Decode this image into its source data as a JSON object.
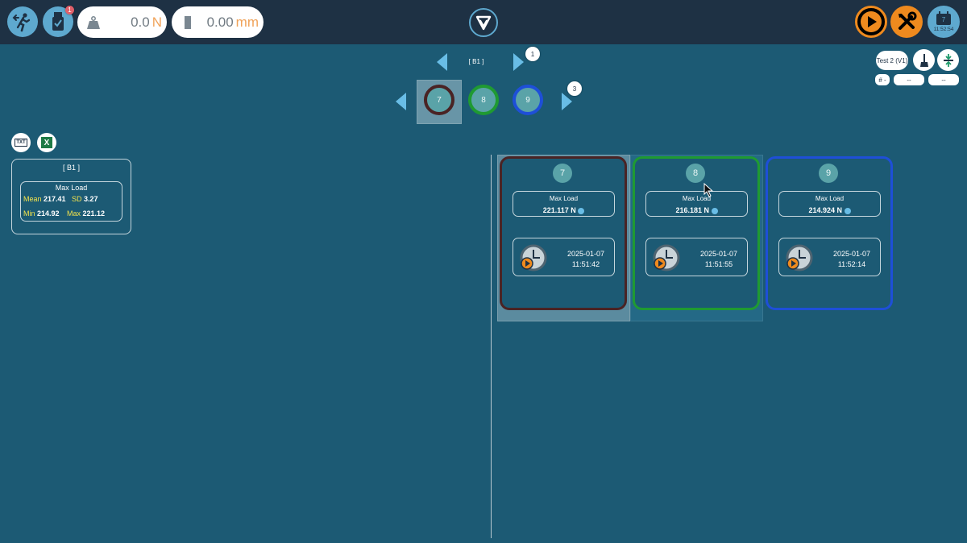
{
  "topbar": {
    "usb_badge": "1",
    "force": {
      "value": "0.0",
      "unit": "N"
    },
    "extension": {
      "value": "0.00",
      "unit": "mm"
    },
    "calendar_day": "7",
    "clock": "11:52:54"
  },
  "batch_nav": {
    "label": "[ B1 ]",
    "badge": "1"
  },
  "specimens": {
    "items": [
      {
        "num": "7",
        "color": "#4a2324"
      },
      {
        "num": "8",
        "color": "#1f9a32"
      },
      {
        "num": "9",
        "color": "#1e4fd8"
      }
    ],
    "badge": "3"
  },
  "right_controls": {
    "test_label": "Test 2 (V1)",
    "hash_label": "# -",
    "field1": "--",
    "field2": "--"
  },
  "export": {
    "txt_label": "TXT",
    "excel_label": "X"
  },
  "summary": {
    "batch": "[ B1 ]",
    "title": "Max Load",
    "mean_label": "Mean",
    "mean": "217.41",
    "sd_label": "SD",
    "sd": "3.27",
    "min_label": "Min",
    "min": "214.92",
    "max_label": "Max",
    "max": "221.12"
  },
  "cards": [
    {
      "num": "7",
      "title": "Max Load",
      "value": "221.117 N",
      "date": "2025-01-07",
      "time": "11:51:42",
      "border": "#4a2324"
    },
    {
      "num": "8",
      "title": "Max Load",
      "value": "216.181 N",
      "date": "2025-01-07",
      "time": "11:51:55",
      "border": "#1f9a32"
    },
    {
      "num": "9",
      "title": "Max Load",
      "value": "214.924 N",
      "date": "2025-01-07",
      "time": "11:52:14",
      "border": "#1e4fd8"
    }
  ]
}
